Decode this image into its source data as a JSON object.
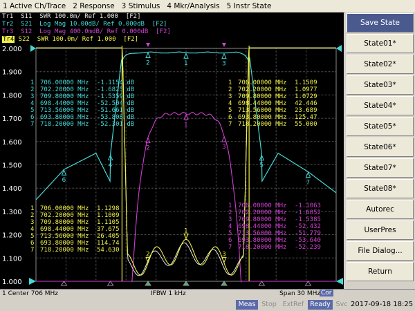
{
  "menu": [
    "1 Active Ch/Trace",
    "2 Response",
    "3 Stimulus",
    "4 Mkr/Analysis",
    "5 Instr State"
  ],
  "traces": [
    {
      "label": "Tr1  S11  SWR 100.0m/ Ref 1.000  [F2]",
      "color": "#e8e8e8"
    },
    {
      "label": "Tr2  S21  Log Mag 10.00dB/ Ref 0.000dB  [F2]",
      "color": "#45d8d8"
    },
    {
      "label": "Tr3  S12  Log Mag 400.0mdB/ Ref 0.000dB  [F2]",
      "color": "#d040d0"
    },
    {
      "tag": "Tr4",
      "label": " S22  SWR 100.0m/ Ref 1.000  [F2]",
      "color": "#f0f048"
    }
  ],
  "chart_data": {
    "type": "line",
    "title": "",
    "xlabel": "Center 706 MHz / Span 30 MHz",
    "ylabel": "",
    "xlim": [
      691,
      721
    ],
    "ylim": [
      1.0,
      2.0
    ],
    "y_ticks": [
      "2.000",
      "1.900",
      "1.800",
      "1.700",
      "1.600",
      "1.500",
      "1.400",
      "1.300",
      "1.200",
      "1.100",
      "1.000"
    ],
    "grid": true,
    "series": [
      {
        "name": "Tr1 S11",
        "color": "#e8e8e8"
      },
      {
        "name": "Tr2 S21",
        "color": "#45d8d8"
      },
      {
        "name": "Tr3 S12",
        "color": "#d040d0"
      },
      {
        "name": "Tr4 S22",
        "color": "#f0f048"
      }
    ],
    "marker_tables": [
      {
        "color": "#45d8d8",
        "rows": [
          [
            "1",
            "706.00000 MHz",
            "-1.1154 dB"
          ],
          [
            "2",
            "702.20000 MHz",
            "-1.6825 dB"
          ],
          [
            "3",
            "709.80000 MHz",
            "-1.5359 dB"
          ],
          [
            "4",
            "698.44000 MHz",
            "-52.504 dB"
          ],
          [
            "5",
            "713.56000 MHz",
            "-51.661 dB"
          ],
          [
            "6",
            "693.80000 MHz",
            "-53.808 dB"
          ],
          [
            "7",
            "718.20000 MHz",
            "-52.301 dB"
          ]
        ]
      },
      {
        "color": "#f0f048",
        "rows": [
          [
            "1",
            "706.00000 MHz",
            "1.1509"
          ],
          [
            "2",
            "702.20000 MHz",
            "1.0977"
          ],
          [
            "3",
            "709.80000 MHz",
            "1.0729"
          ],
          [
            "4",
            "698.44000 MHz",
            "42.446"
          ],
          [
            "5",
            "713.56000 MHz",
            "23.689"
          ],
          [
            "6",
            "693.80000 MHz",
            "125.47"
          ],
          [
            "7",
            "718.20000 MHz",
            "55.000"
          ]
        ]
      },
      {
        "color": "#d040d0",
        "rows": [
          [
            "1",
            "706.00000 MHz",
            "-1.1063"
          ],
          [
            "2",
            "702.20000 MHz",
            "-1.6852"
          ],
          [
            "3",
            "709.80000 MHz",
            "-1.5385"
          ],
          [
            "4",
            "698.44000 MHz",
            "-52.432"
          ],
          [
            "5",
            "713.56000 MHz",
            "-51.779"
          ],
          [
            "6",
            "693.80000 MHz",
            "-53.640"
          ],
          [
            "7",
            "718.20000 MHz",
            "-52.239"
          ]
        ]
      },
      {
        "color": "#f0f048",
        "rows": [
          [
            "1",
            "706.00000 MHz",
            "1.1298"
          ],
          [
            "2",
            "702.20000 MHz",
            "1.1009"
          ],
          [
            "3",
            "709.80000 MHz",
            "1.1105"
          ],
          [
            "4",
            "698.44000 MHz",
            "37.675"
          ],
          [
            "5",
            "713.56000 MHz",
            "26.405"
          ],
          [
            "6",
            "693.80000 MHz",
            "114.74"
          ],
          [
            "7",
            "718.20000 MHz",
            "54.630"
          ]
        ]
      }
    ]
  },
  "softkeys": [
    {
      "label": "Save State",
      "active": true
    },
    {
      "label": "State01*"
    },
    {
      "label": "State02*"
    },
    {
      "label": "State03*"
    },
    {
      "label": "State04*"
    },
    {
      "label": "State05*"
    },
    {
      "label": "State06*"
    },
    {
      "label": "State07*"
    },
    {
      "label": "State08*"
    },
    {
      "label": "Autorec"
    },
    {
      "label": "UserPres"
    },
    {
      "label": "File Dialog..."
    },
    {
      "label": "Return"
    }
  ],
  "info": {
    "center": "1  Center 706 MHz",
    "ifbw": "IFBW 1 kHz",
    "span": "Span 30 MHz",
    "cor": "Cor"
  },
  "status": {
    "items": [
      {
        "label": "Meas",
        "bg": "#5b6aa8",
        "fg": "#ffffff"
      },
      {
        "label": "Stop",
        "bg": "#d4d0c8",
        "fg": "#8c8c8c"
      },
      {
        "label": "ExtRef",
        "bg": "#d4d0c8",
        "fg": "#8c8c8c"
      },
      {
        "label": "Ready",
        "bg": "#5b6aa8",
        "fg": "#ffffff"
      },
      {
        "label": "Svc",
        "bg": "#d4d0c8",
        "fg": "#8c8c8c"
      }
    ],
    "datetime": "2017-09-18 18:25"
  }
}
